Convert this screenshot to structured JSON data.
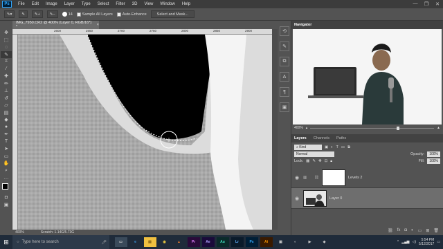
{
  "app": {
    "logo": "Ps"
  },
  "menu": [
    "File",
    "Edit",
    "Image",
    "Layer",
    "Type",
    "Select",
    "Filter",
    "3D",
    "View",
    "Window",
    "Help"
  ],
  "window_buttons": [
    "—",
    "❐",
    "✕"
  ],
  "options": {
    "brush_size": "14",
    "sample_all_layers": "Sample All Layers",
    "auto_enhance": "Auto-Enhance",
    "select_and_mask": "Select and Mask..."
  },
  "document": {
    "tab_title": "IMG_7950.CR2 @ 400% (Layer 0, RGB/16*) *",
    "tab_close": "×",
    "zoom": "400%",
    "scratch": "Scratch: 1.14G/5.73G",
    "ruler_ticks": [
      "2600",
      "2650",
      "2700",
      "2750",
      "2800",
      "2850",
      "2900",
      "2950"
    ]
  },
  "navigator": {
    "tab": "Navigator",
    "zoom": "400%"
  },
  "layers_panel": {
    "tabs": [
      "Layers",
      "Channels",
      "Paths"
    ],
    "kind_label": "Kind",
    "blend_mode": "Normal",
    "opacity_label": "Opacity:",
    "opacity_value": "100%",
    "lock_label": "Lock:",
    "fill_label": "Fill:",
    "fill_value": "100%",
    "layers": [
      {
        "name": "Levels 2",
        "selected": false
      },
      {
        "name": "Layer 0",
        "selected": true
      }
    ]
  },
  "taskbar": {
    "search_placeholder": "Type here to search",
    "apps": [
      {
        "label": "▭",
        "color": "#3a4a5a",
        "fg": "#ddd"
      },
      {
        "label": "e",
        "color": "#1f2b3a",
        "fg": "#3a9ae8"
      },
      {
        "label": "▤",
        "color": "#f0c040",
        "fg": "#7a5a10"
      },
      {
        "label": "◉",
        "color": "#1f2b3a",
        "fg": "#e8c840"
      },
      {
        "label": "▲",
        "color": "#1f2b3a",
        "fg": "#e87a2a"
      },
      {
        "label": "Pr",
        "color": "#2a0a3a",
        "fg": "#e080ff"
      },
      {
        "label": "Ae",
        "color": "#1a0a3a",
        "fg": "#b0a0ff"
      },
      {
        "label": "Au",
        "color": "#0a2a2a",
        "fg": "#40e0c0"
      },
      {
        "label": "Lr",
        "color": "#0a1a2a",
        "fg": "#60b0ff"
      },
      {
        "label": "Ps",
        "color": "#001e36",
        "fg": "#31a8ff"
      },
      {
        "label": "Ai",
        "color": "#3a1a00",
        "fg": "#ff9a00"
      },
      {
        "label": "▣",
        "color": "#1f2b3a",
        "fg": "#ccc"
      },
      {
        "label": "◐",
        "color": "#1f2b3a",
        "fg": "#ccc"
      },
      {
        "label": "▶",
        "color": "#1f2b3a",
        "fg": "#ccc"
      },
      {
        "label": "◈",
        "color": "#1f2b3a",
        "fg": "#ccc"
      }
    ],
    "time": "5:54 PM",
    "date": "5/12/2017"
  }
}
